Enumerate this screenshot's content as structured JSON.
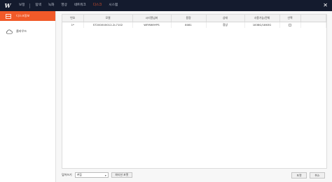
{
  "app": {
    "logo": "W",
    "menu": [
      "보정",
      "탐색",
      "녹화",
      "영상",
      "네트워크",
      "디스크",
      "시스템"
    ],
    "active_menu_index": 5,
    "close_icon": "close-icon"
  },
  "sidebar": {
    "items": [
      {
        "label": "디스크정보",
        "icon": "disk-icon",
        "active": true
      },
      {
        "label": "클라우드",
        "icon": "cloud-icon",
        "active": false
      }
    ]
  },
  "table": {
    "columns": [
      "번호",
      "모델",
      "시리얼넘버",
      "용량",
      "상태",
      "사용가능/전체",
      "선택"
    ],
    "rows": [
      {
        "no": "1*",
        "model": "ST2000VX012-2L7102",
        "serial": "WFMW9YPS",
        "capacity": "8081",
        "status": "정상",
        "usage": "1838G/1863G",
        "selected": false
      }
    ]
  },
  "bottom": {
    "label": "덮어쓰기",
    "select_value": "켜짐",
    "setup_button": "파티션 포맷"
  },
  "footer": {
    "apply_label": "포맷",
    "cancel_label": "취소"
  },
  "colors": {
    "topbar": "#141b2e",
    "accent": "#f15a29"
  }
}
